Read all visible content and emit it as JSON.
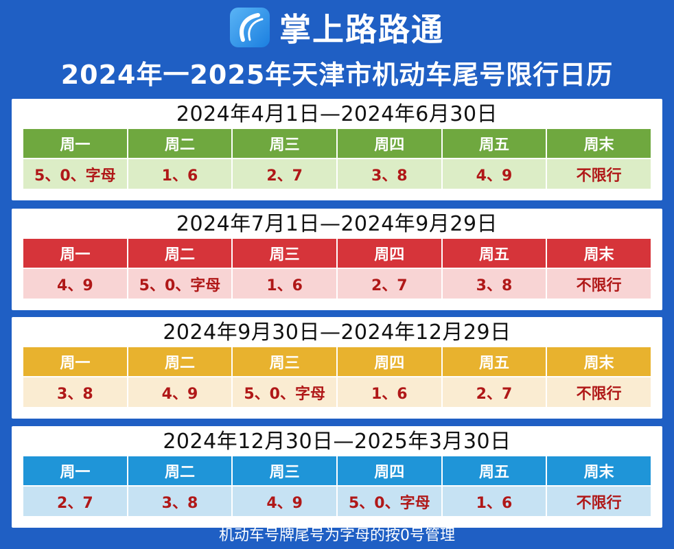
{
  "brand": {
    "name": "掌上路路通",
    "logo_icon": "road-curve-logo-icon"
  },
  "title": "2024年一2025年天津市机动车尾号限行日历",
  "periods": [
    {
      "range": "2024年4月1日—2024年6月30日",
      "header_color": "#6fa83f",
      "row_color": "#dcedc6",
      "days": [
        "周一",
        "周二",
        "周三",
        "周四",
        "周五",
        "周末"
      ],
      "values": [
        "5、0、字母",
        "1、6",
        "2、7",
        "3、8",
        "4、9",
        "不限行"
      ]
    },
    {
      "range": "2024年7月1日—2024年9月29日",
      "header_color": "#d6343a",
      "row_color": "#f8d4d4",
      "days": [
        "周一",
        "周二",
        "周三",
        "周四",
        "周五",
        "周末"
      ],
      "values": [
        "4、9",
        "5、0、字母",
        "1、6",
        "2、7",
        "3、8",
        "不限行"
      ]
    },
    {
      "range": "2024年9月30日—2024年12月29日",
      "header_color": "#e8b22e",
      "row_color": "#faecd2",
      "days": [
        "周一",
        "周二",
        "周三",
        "周四",
        "周五",
        "周末"
      ],
      "values": [
        "3、8",
        "4、9",
        "5、0、字母",
        "1、6",
        "2、7",
        "不限行"
      ]
    },
    {
      "range": "2024年12月30日—2025年3月30日",
      "header_color": "#1f95d8",
      "row_color": "#c6e2f3",
      "days": [
        "周一",
        "周二",
        "周三",
        "周四",
        "周五",
        "周末"
      ],
      "values": [
        "2、7",
        "3、8",
        "4、9",
        "5、0、字母",
        "1、6",
        "不限行"
      ]
    }
  ],
  "footer_note": "机动车号牌尾号为字母的按0号管理",
  "colors": {
    "background": "#1f5fc4",
    "value_text": "#b01818"
  }
}
